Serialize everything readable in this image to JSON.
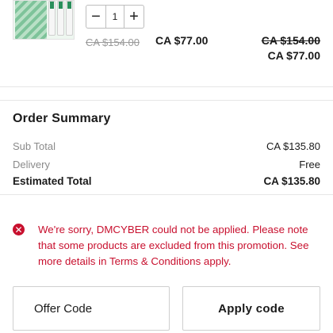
{
  "cart_item": {
    "image_icon": "product-kit-icon",
    "quantity": "1",
    "minus_label": "−",
    "plus_label": "+",
    "original_price": "CA $154.00",
    "sale_price": "CA $77.00",
    "line_original": "CA $154.00",
    "line_sale": "CA $77.00"
  },
  "summary": {
    "title": "Order Summary",
    "subtotal_label": "Sub Total",
    "subtotal_value": "CA $135.80",
    "delivery_label": "Delivery",
    "delivery_value": "Free",
    "total_label": "Estimated Total",
    "total_value": "CA $135.80"
  },
  "error": {
    "icon": "error-icon",
    "icon_glyph": "✕",
    "message_lead": "We're sorry, DMCYBER could not be applied. Please note that some products are excluded from this promotion. See more details in ",
    "link_text": "Terms & Conditions",
    "message_tail": " apply.",
    "color": "#c8102e"
  },
  "offer": {
    "placeholder": "Offer Code",
    "apply_label": "Apply code"
  }
}
